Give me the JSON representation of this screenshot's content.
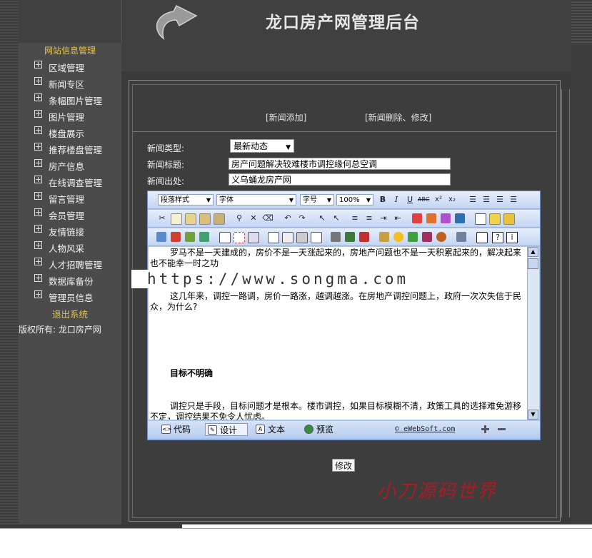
{
  "header": {
    "title": "龙口房产网管理后台"
  },
  "sidebar": {
    "section_title": "网站信息管理",
    "items": [
      {
        "label": "区域管理"
      },
      {
        "label": "新闻专区"
      },
      {
        "label": "条幅图片管理"
      },
      {
        "label": "图片管理"
      },
      {
        "label": "楼盘展示"
      },
      {
        "label": "推荐楼盘管理"
      },
      {
        "label": "房产信息"
      },
      {
        "label": "在线调查管理"
      },
      {
        "label": "留言管理"
      },
      {
        "label": "会员管理"
      },
      {
        "label": "友情链接"
      },
      {
        "label": "人物风采"
      },
      {
        "label": "人才招聘管理"
      },
      {
        "label": "数据库备份"
      },
      {
        "label": "管理员信息"
      }
    ],
    "logout": "退出系统",
    "copyright": "版权所有: 龙口房产网"
  },
  "tabs": {
    "add": "[新闻添加]",
    "edit": "[新闻删除、修改]"
  },
  "form": {
    "type_label": "新闻类型:",
    "type_value": "最新动态",
    "title_label": "新闻标题:",
    "title_value": "房产问题解决较难楼市调控缘何总空调",
    "source_label": "新闻出处:",
    "source_value": "义乌蛹龙房产网"
  },
  "editor": {
    "toolbar": {
      "paragraph_style": "段落样式",
      "font": "字体",
      "font_size": "字号",
      "zoom": "100%"
    },
    "content": [
      "罗马不是一天建成的，房价不是一天涨起来的，房地产问题也不是一天积累起来的，解决起来也不能幸一时之功",
      "这几年来，调控一路调，房价一路涨，越调越涨。在房地产调控问题上，政府一次次失信于民众，为什么?",
      "目标不明确",
      "调控只是手段，目标问题才是根本。楼市调控，如果目标模糊不清，政策工具的选择难免游移不定，调控结果不免令人忧虑。"
    ],
    "modes": {
      "code": "代码",
      "design": "设计",
      "text": "文本",
      "preview": "预览"
    },
    "brand": "eWebSoft.com",
    "brand_prefix": "©"
  },
  "submit_label": "修改",
  "watermark": "https://www.songma.com",
  "signature": "小刀源码世界",
  "colors": {
    "accent_yellow": "#e8c24a",
    "frame_dark": "#3e3e3e",
    "editor_blue": "#a9c5ee",
    "signature_red": "#b81822"
  }
}
